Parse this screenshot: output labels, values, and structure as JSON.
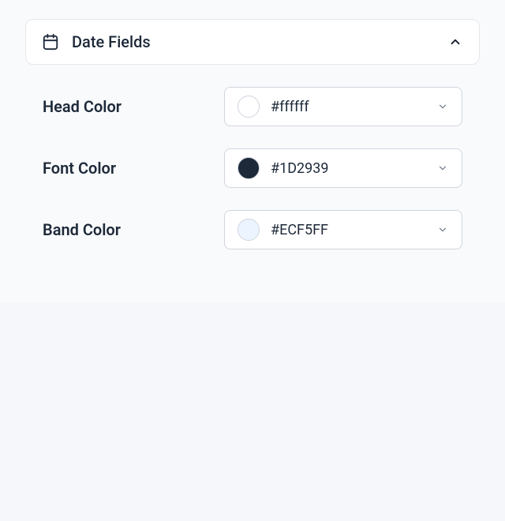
{
  "section": {
    "title": "Date Fields",
    "expanded": true
  },
  "fields": [
    {
      "label": "Head Color",
      "value": "#ffffff",
      "swatch": "#ffffff"
    },
    {
      "label": "Font Color",
      "value": "#1D2939",
      "swatch": "#1D2939"
    },
    {
      "label": "Band Color",
      "value": "#ECF5FF",
      "swatch": "#ECF5FF"
    }
  ]
}
